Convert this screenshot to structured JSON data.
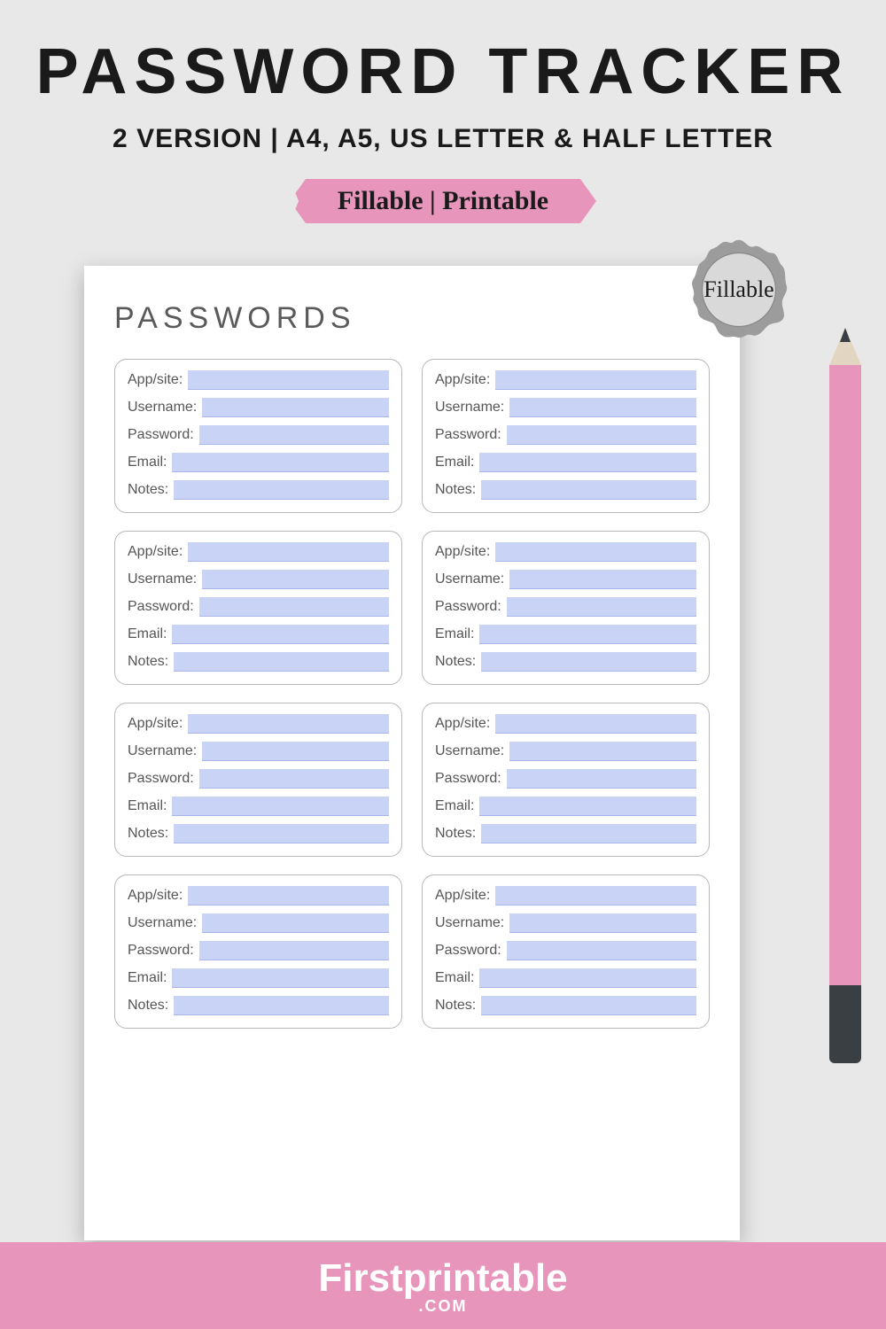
{
  "header": {
    "title": "PASSWORD TRACKER",
    "subtitle": "2 VERSION | A4, A5, US LETTER & HALF LETTER",
    "ribbon": "Fillable | Printable"
  },
  "badge": {
    "label": "Fillable"
  },
  "sheet": {
    "title": "PASSWORDS",
    "fields": {
      "app": "App/site:",
      "username": "Username:",
      "password": "Password:",
      "email": "Email:",
      "notes": "Notes:"
    },
    "card_count": 8
  },
  "footer": {
    "brand": "Firstprintable",
    "tld": ".COM"
  }
}
